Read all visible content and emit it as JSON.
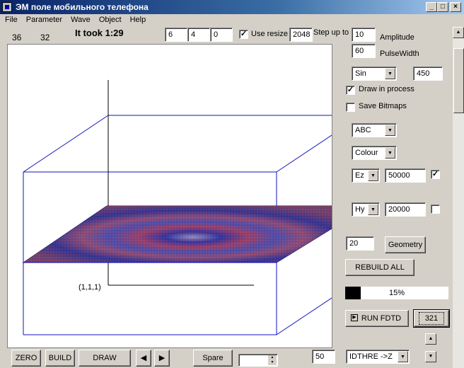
{
  "window": {
    "title": "ЭМ поле мобильного телефона"
  },
  "menu": [
    "File",
    "Parameter",
    "Wave",
    "Object",
    "Help"
  ],
  "header": {
    "counter_a": "36",
    "counter_b": "32",
    "elapsed": "It took 1:29",
    "grid_x": "6",
    "grid_y": "4",
    "grid_z": "0",
    "use_resize_label": "Use resize",
    "use_resize_checked": true,
    "resize_value": "2048",
    "step_up_label": "Step up to"
  },
  "right_panel": {
    "amplitude_value": "10",
    "amplitude_label": "Amplitude",
    "pulsewidth_value": "60",
    "pulsewidth_label": "PulseWidth",
    "wave_type": "Sin",
    "wave_value": "450",
    "draw_in_process_label": "Draw in process",
    "draw_in_process_checked": true,
    "save_bitmaps_label": "Save Bitmaps",
    "save_bitmaps_checked": false,
    "abc_select": "ABC",
    "colour_select": "Colour",
    "field1_select": "Ez",
    "field1_value": "50000",
    "field1_checked": true,
    "field2_select": "Hy",
    "field2_value": "20000",
    "field2_checked": false,
    "geometry_value": "20",
    "geometry_button": "Geometry",
    "rebuild_button": "REBUILD ALL",
    "progress_percent": 15,
    "progress_label": "15%",
    "run_button": "RUN FDTD",
    "iteration_button": "321",
    "bottom_value": "50",
    "threshold_select": "IDTHRE ->Z"
  },
  "canvas": {
    "origin_label": "(1,1,1)"
  },
  "bottom_bar": {
    "zero_button": "ZERO",
    "build_button": "BUILD",
    "draw_button": "DRAW",
    "prev_button": "◀",
    "next_button": "▶",
    "spare_button": "Spare"
  }
}
